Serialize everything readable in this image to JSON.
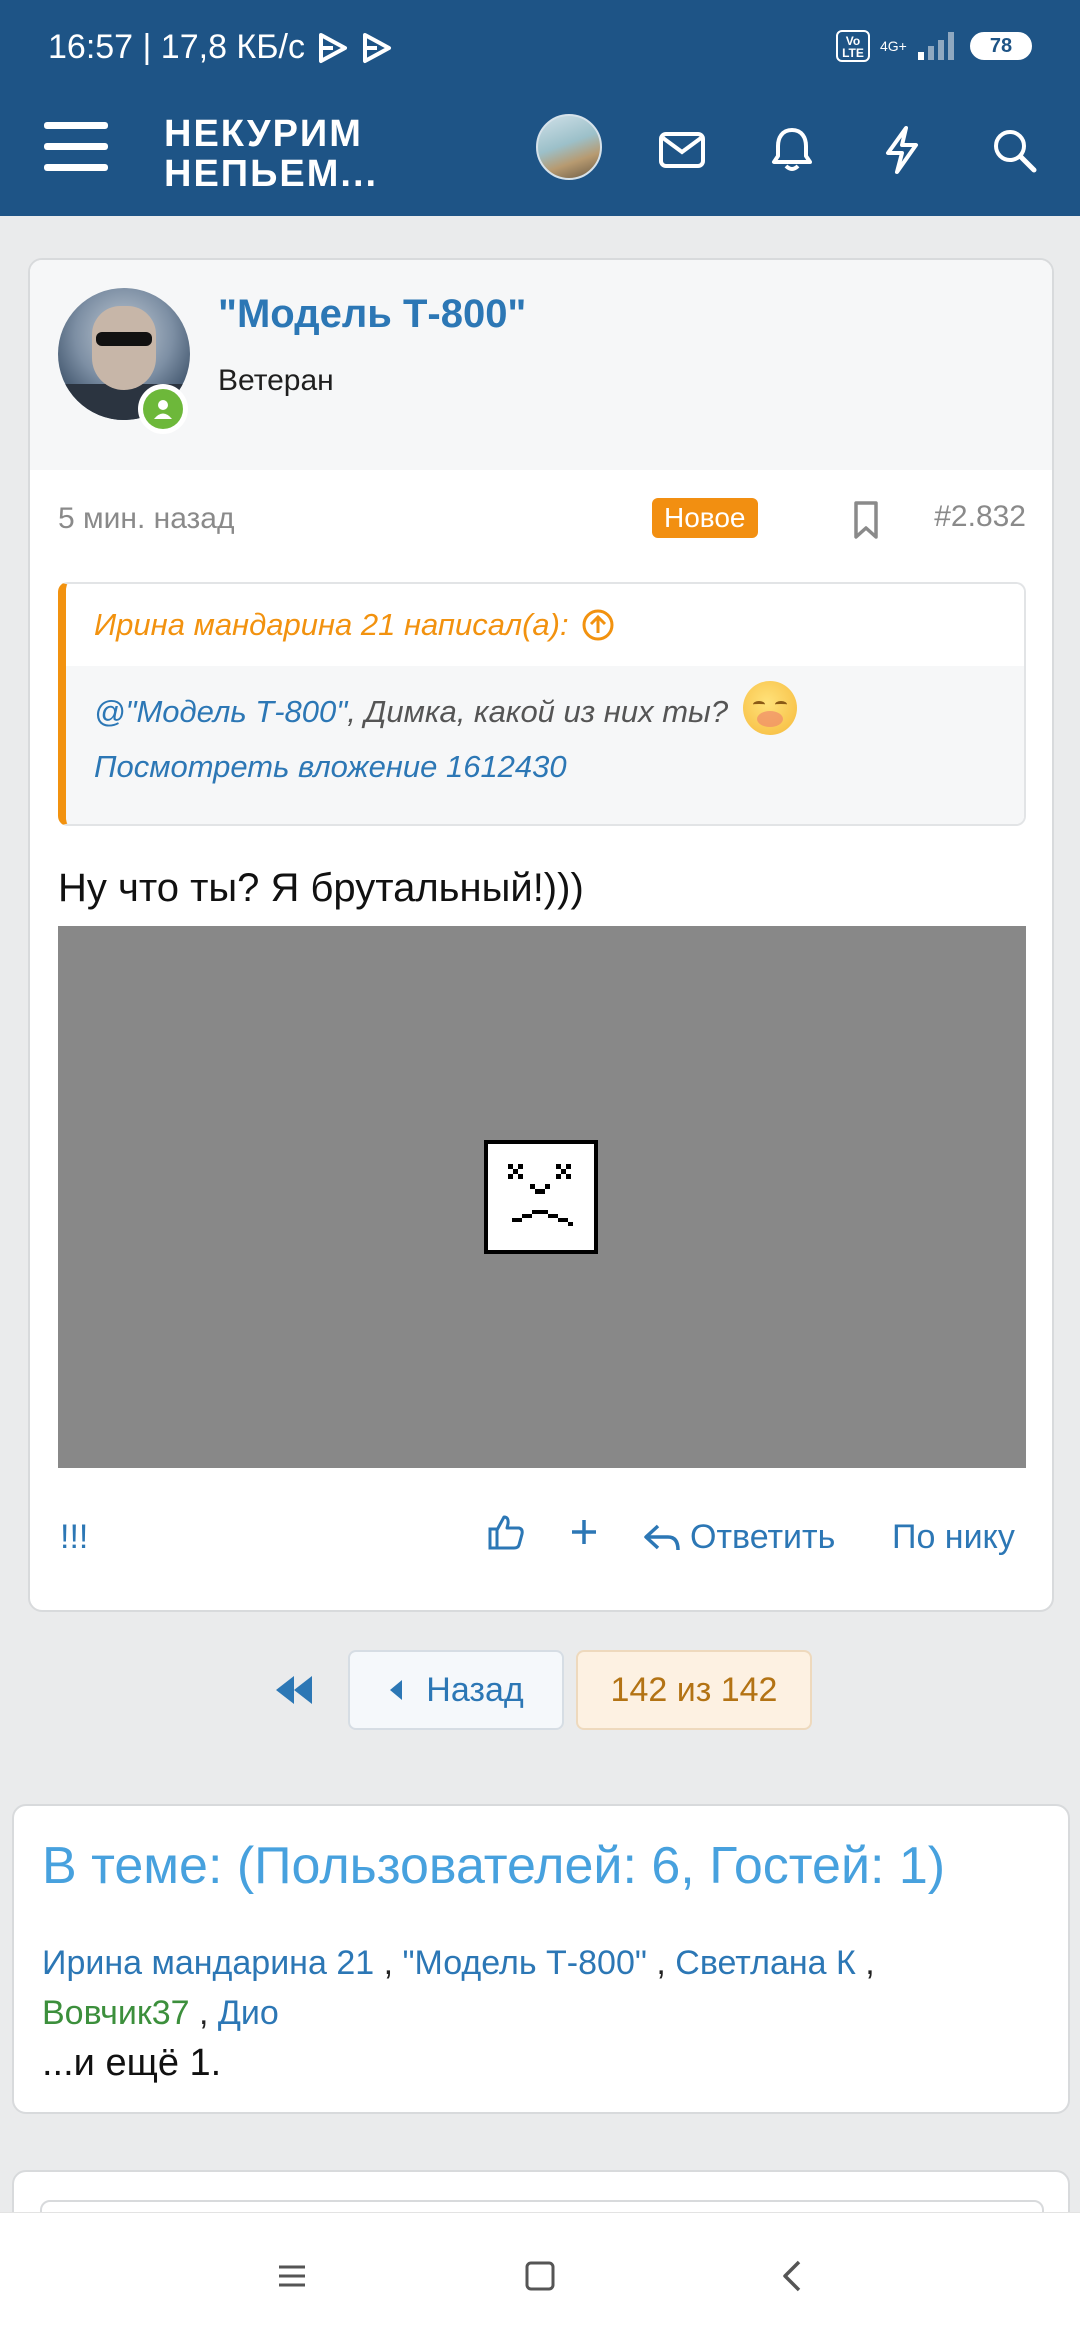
{
  "status_bar": {
    "time_speed": "16:57 | 17,8 КБ/с",
    "volte": "Vo LTE",
    "network": "4G+",
    "battery": "78"
  },
  "header": {
    "logo_line1": "НЕКУРИМ",
    "logo_line2": "НЕПЬЕМ...",
    "icons": [
      "menu-icon",
      "avatar",
      "mail-icon",
      "bell-icon",
      "lightning-icon",
      "search-icon"
    ],
    "brand_color": "#1e5486"
  },
  "post": {
    "author": "\"Модель Т-800\"",
    "role": "Ветеран",
    "time": "5 мин. назад",
    "badge": "Новое",
    "number": "#2.832",
    "quote": {
      "author_line": "Ирина мандарина 21 написал(а):",
      "mention": "@\"Модель Т-800\"",
      "text": ", Димка, какой из них ты?",
      "attachment": "Посмотреть вложение 1612430"
    },
    "message": "Ну что ты? Я брутальный!)))",
    "actions": {
      "exclaim": "!!!",
      "reply": "Ответить",
      "by_nick": "По нику"
    }
  },
  "pagination": {
    "back": "Назад",
    "current": "142 из 142"
  },
  "online": {
    "title": "В теме: (Пользователей: 6, Гостей: 1)",
    "users": [
      "Ирина мандарина 21",
      "\"Модель Т-800\"",
      "Светлана К",
      "Вовчик37",
      "Дио"
    ],
    "more": "...и ещё 1."
  },
  "colors": {
    "accent": "#2c77b5",
    "quote_border": "#f2920f",
    "badge": "#f28f11",
    "online_title": "#47a1de"
  }
}
